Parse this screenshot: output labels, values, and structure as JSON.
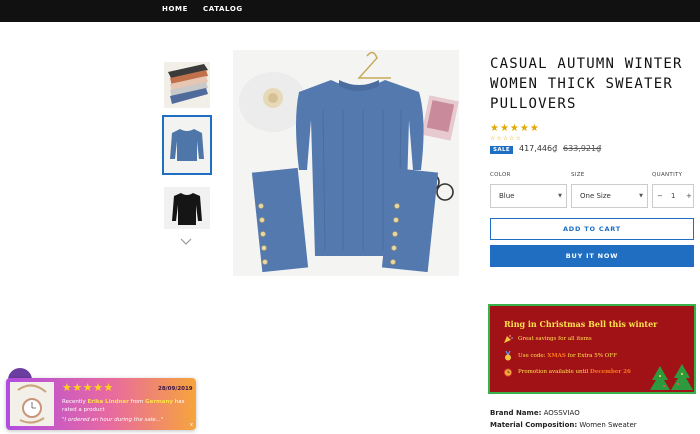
{
  "nav": {
    "items": [
      "HOME",
      "CATALOG"
    ]
  },
  "product": {
    "title": "CASUAL AUTUMN WINTER WOMEN THICK SWEATER PULLOVERS",
    "stars": "★★★★★",
    "stars_small": "☆☆☆☆☆",
    "rating": 5,
    "sale_badge": "SALE",
    "price": "417,446₫",
    "compare_price": "633,921₫",
    "main_image": "blue-sweater-image",
    "thumbnails": [
      "sweaters-stack-image",
      "blue-sweater-image",
      "black-sweater-image"
    ]
  },
  "options": {
    "color_label": "COLOR",
    "color_value": "Blue",
    "size_label": "SIZE",
    "size_value": "One Size",
    "quantity_label": "QUANTITY",
    "quantity_value": "1",
    "minus": "−",
    "plus": "+",
    "caret": "▼"
  },
  "actions": {
    "add_to_cart": "ADD TO CART",
    "buy_now": "BUY IT NOW"
  },
  "promo": {
    "title": "Ring in Christmas Bell this winter",
    "line1": "Great savings for all items",
    "line2_prefix": "Use code: ",
    "line2_code": "XMAS",
    "line2_suffix": " for Extra 5% OFF",
    "line3_prefix": "Promotion available until ",
    "line3_date": "December 26"
  },
  "specs": [
    {
      "label": "Brand Name:",
      "value": "AOSSVIAO"
    },
    {
      "label": "Material Composition:",
      "value": "Women Sweater"
    }
  ],
  "review_popup": {
    "stars": "★★★★★",
    "date": "28/09/2019",
    "line1_prefix": "Recently ",
    "name": "Erika Lindner",
    "line1_mid": " from ",
    "country": "Germany",
    "line1_suffix": " has",
    "line2": "rated a product",
    "quote": "\"I ordered an hour during the sale...\"",
    "close": "x"
  },
  "colors": {
    "accent": "#1f6ec2",
    "promo_bg": "#a11217",
    "promo_border": "#3ab14b",
    "star": "#e0a800"
  }
}
